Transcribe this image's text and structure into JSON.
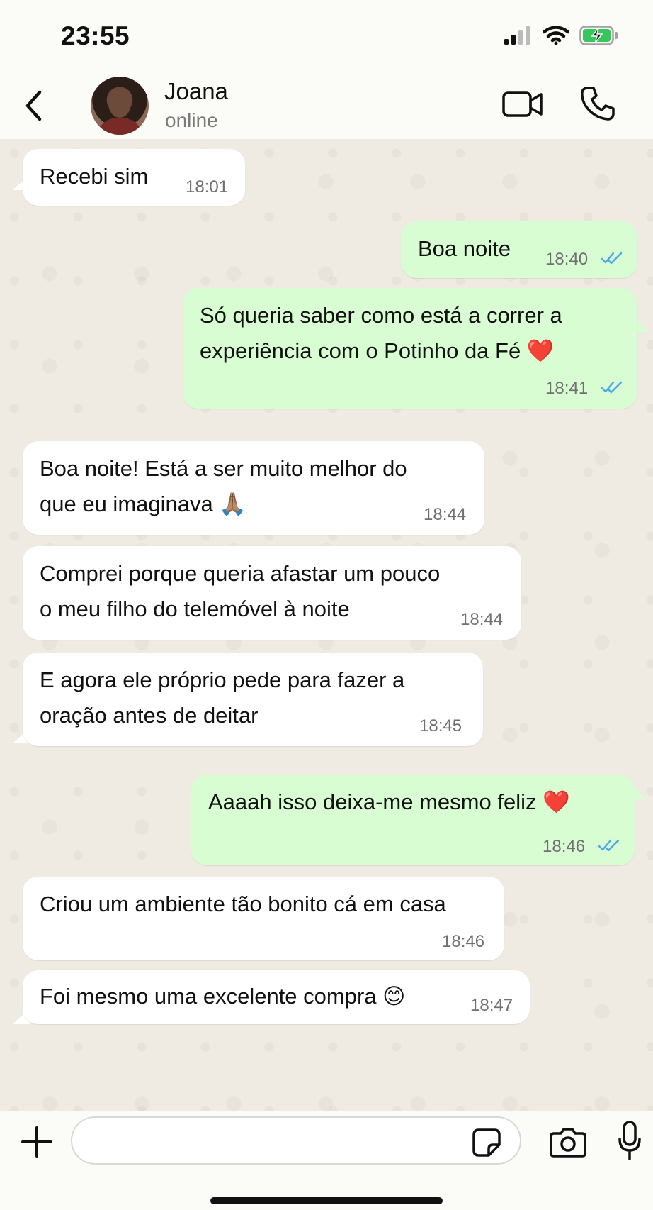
{
  "status_bar": {
    "time": "23:55"
  },
  "header": {
    "contact_name": "Joana",
    "contact_status": "online"
  },
  "messages": [
    {
      "direction": "in",
      "text": "Recebi sim",
      "time": "18:01"
    },
    {
      "direction": "out",
      "text": "Boa noite",
      "time": "18:40",
      "read": true
    },
    {
      "direction": "out",
      "text_line1": "Só queria saber como está a correr a",
      "text_line2": "experiência com o Potinho da Fé",
      "emoji": "❤️",
      "time": "18:41",
      "read": true
    },
    {
      "direction": "in",
      "text_line1": "Boa noite! Está a ser muito melhor do",
      "text_line2": "que eu imaginava",
      "emoji": "🙏🏽",
      "time": "18:44"
    },
    {
      "direction": "in",
      "text_line1": "Comprei porque queria afastar um pouco",
      "text_line2": "o meu filho do telemóvel à noite",
      "time": "18:44"
    },
    {
      "direction": "in",
      "text_line1": "E agora ele próprio pede para fazer a",
      "text_line2": "oração antes de deitar",
      "time": "18:45"
    },
    {
      "direction": "out",
      "text": "Aaaah isso deixa-me mesmo feliz",
      "emoji": "❤️",
      "time": "18:46",
      "read": true
    },
    {
      "direction": "in",
      "text": "Criou um ambiente tão bonito cá em casa",
      "time": "18:46"
    },
    {
      "direction": "in",
      "text": "Foi mesmo uma excelente compra",
      "emoji": "😊",
      "time": "18:47"
    }
  ],
  "composer": {
    "placeholder": ""
  },
  "icons": {
    "back": "chevron-left-icon",
    "video": "video-camera-icon",
    "call": "phone-icon",
    "plus": "plus-icon",
    "sticker": "sticker-icon",
    "camera": "camera-icon",
    "mic": "microphone-icon"
  },
  "colors": {
    "outgoing_bubble": "#d9fdd3",
    "incoming_bubble": "#ffffff",
    "read_ticks": "#4fa9e6",
    "battery": "#35c759"
  }
}
